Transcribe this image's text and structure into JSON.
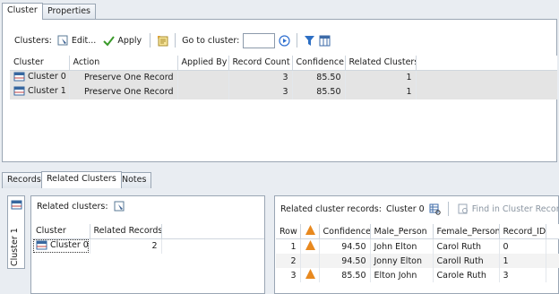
{
  "top_tabs": [
    "Cluster",
    "Properties"
  ],
  "toolbar": {
    "clusters_label": "Clusters:",
    "edit_label": "Edit...",
    "apply_label": "Apply",
    "goto_label": "Go to cluster:",
    "goto_value": ""
  },
  "clusters_grid": {
    "columns": [
      "Cluster",
      "Action",
      "Applied By",
      "Record Count",
      "Confidence",
      "Related Clusters"
    ],
    "rows": [
      {
        "cluster": "Cluster 0",
        "action": "Preserve One Record",
        "applied_by": "",
        "record_count": "3",
        "confidence": "85.50",
        "related": "1"
      },
      {
        "cluster": "Cluster 1",
        "action": "Preserve One Record",
        "applied_by": "",
        "record_count": "3",
        "confidence": "85.50",
        "related": "1"
      }
    ]
  },
  "bottom_tabs": [
    "Records",
    "Related Clusters",
    "Notes"
  ],
  "side_tab_label": "Cluster 1",
  "related_clusters": {
    "label": "Related clusters:",
    "columns": [
      "Cluster",
      "Related Records"
    ],
    "rows": [
      {
        "cluster": "Cluster 0",
        "related_records": "2"
      }
    ]
  },
  "related_records": {
    "label": "Related cluster records:",
    "cluster_name": "Cluster 0",
    "find_label": "Find in Cluster Records",
    "columns": [
      "Row",
      "",
      "Confidence",
      "Male_Person",
      "Female_Person",
      "Record_ID"
    ],
    "rows": [
      {
        "row": "1",
        "warn": true,
        "confidence": "94.50",
        "male": "John Elton",
        "female": "Carol Ruth",
        "record_id": "0"
      },
      {
        "row": "2",
        "warn": false,
        "confidence": "94.50",
        "male": "Jonny Elton",
        "female": "Caroll Ruth",
        "record_id": "1"
      },
      {
        "row": "3",
        "warn": true,
        "confidence": "85.50",
        "male": "Elton John",
        "female": "Carole Ruth",
        "record_id": "3"
      }
    ]
  },
  "colors": {
    "warning": "#e8891f",
    "play": "#2f6fd0",
    "apply": "#3a9a2a",
    "filter": "#2d6fc4"
  }
}
